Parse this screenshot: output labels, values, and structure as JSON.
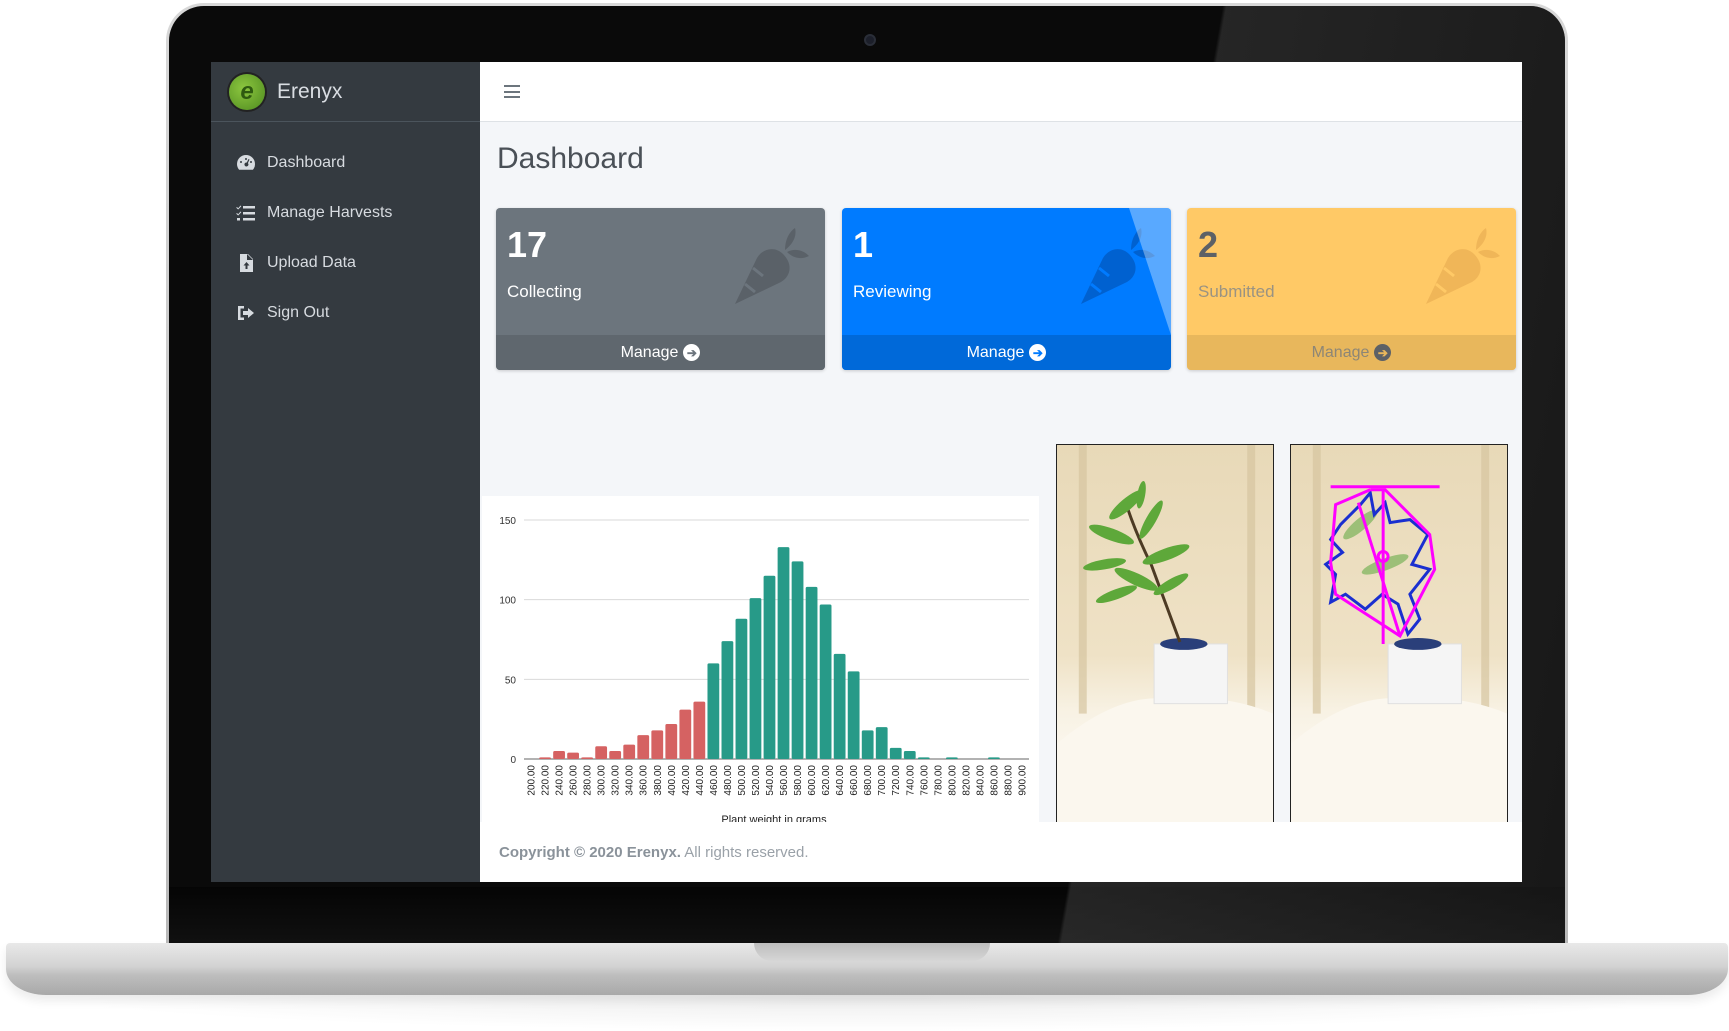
{
  "app": {
    "brand": "Erenyx",
    "logo_letter": "e"
  },
  "sidebar": {
    "items": [
      {
        "label": "Dashboard",
        "icon": "tachometer-icon"
      },
      {
        "label": "Manage Harvests",
        "icon": "tasks-list-icon"
      },
      {
        "label": "Upload Data",
        "icon": "file-upload-icon"
      },
      {
        "label": "Sign Out",
        "icon": "sign-out-icon"
      }
    ]
  },
  "topbar": {
    "menu_icon": "hamburger-icon"
  },
  "page": {
    "title": "Dashboard"
  },
  "cards": [
    {
      "count": "17",
      "label": "Collecting",
      "action": "Manage",
      "icon": "carrot-icon",
      "color": "#6c757d"
    },
    {
      "count": "1",
      "label": "Reviewing",
      "action": "Manage",
      "icon": "carrot-icon",
      "color": "#007bff"
    },
    {
      "count": "2",
      "label": "Submitted",
      "action": "Manage",
      "icon": "carrot-icon",
      "color": "#ffc966"
    }
  ],
  "images": [
    {
      "alt": "Plant photo"
    },
    {
      "alt": "Plant photo with contour and convex hull overlay"
    }
  ],
  "footer": {
    "copyright": "Copyright © 2020 Erenyx.",
    "rights": " All rights reserved."
  },
  "chart_data": {
    "type": "bar",
    "title": "",
    "xlabel": "Plant weight in grams",
    "ylabel": "",
    "ylim": [
      0,
      150
    ],
    "yticks": [
      0,
      50,
      100,
      150
    ],
    "grid": true,
    "legend": "none",
    "threshold_color_below": "#d56262",
    "threshold_color_above": "#279a88",
    "threshold": 460,
    "categories": [
      "200.00",
      "220.00",
      "240.00",
      "260.00",
      "280.00",
      "300.00",
      "320.00",
      "340.00",
      "360.00",
      "380.00",
      "400.00",
      "420.00",
      "440.00",
      "460.00",
      "480.00",
      "500.00",
      "520.00",
      "540.00",
      "560.00",
      "580.00",
      "600.00",
      "620.00",
      "640.00",
      "660.00",
      "680.00",
      "700.00",
      "720.00",
      "740.00",
      "760.00",
      "780.00",
      "800.00",
      "820.00",
      "840.00",
      "860.00",
      "880.00",
      "900.00"
    ],
    "values": [
      0,
      1,
      5,
      4,
      1,
      8,
      5,
      9,
      15,
      18,
      22,
      31,
      36,
      60,
      74,
      88,
      101,
      115,
      133,
      124,
      108,
      97,
      66,
      55,
      18,
      20,
      7,
      5,
      1,
      0,
      1,
      0,
      0,
      1,
      0,
      0
    ]
  }
}
